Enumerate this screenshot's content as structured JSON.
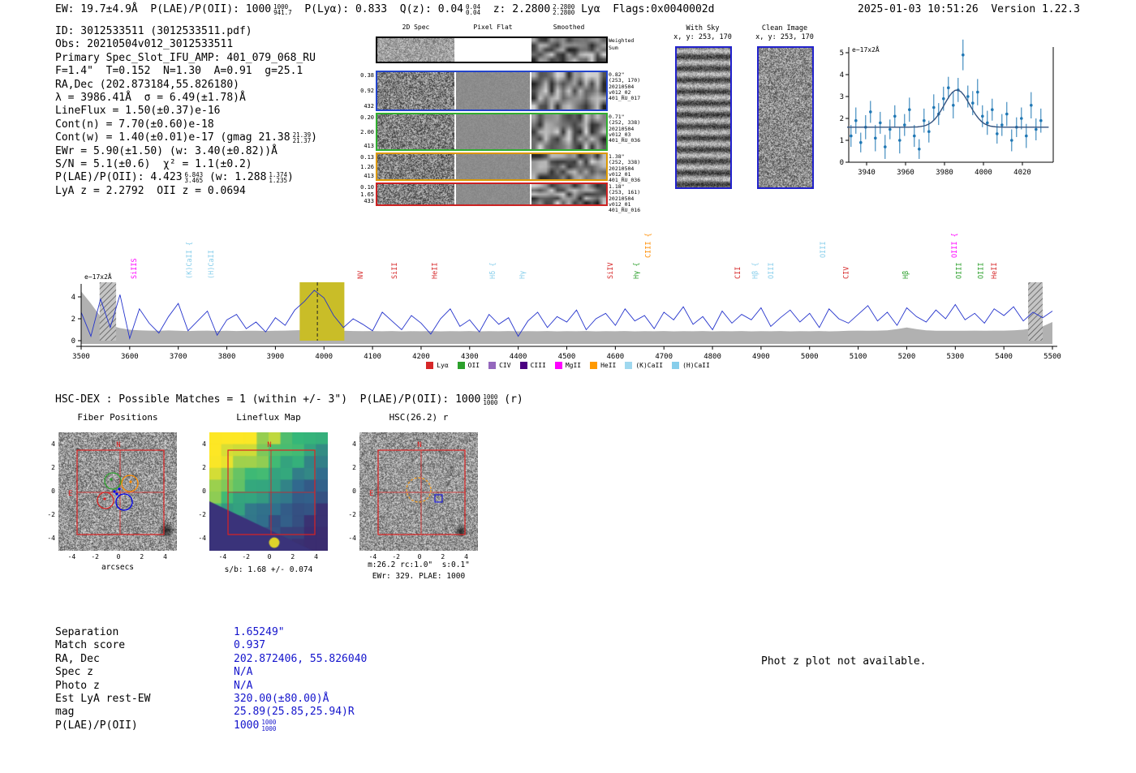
{
  "meta": {
    "datetime_version": "2025-01-03 10:51:26  Version 1.22.3"
  },
  "header_segments": [
    {
      "t": "EW: 19.7±4.9Å  P(LAE)/P(OII): 1000"
    },
    {
      "f": [
        "1000",
        "941.7"
      ]
    },
    {
      "t": "  P(Lyα): 0.833  Q(z): 0.04"
    },
    {
      "f": [
        "0.04",
        "0.04"
      ]
    },
    {
      "t": "  z: 2.2800"
    },
    {
      "f": [
        "2.2800",
        "2.2800"
      ]
    },
    {
      "t": " Lyα  Flags:0x0040002d"
    }
  ],
  "info_lines": [
    [
      {
        "t": "ID: 3012533511 (3012533511.pdf)"
      }
    ],
    [
      {
        "t": "Obs: 20210504v012_3012533511"
      }
    ],
    [
      {
        "t": "Primary Spec_Slot_IFU_AMP: 401_079_068_RU"
      }
    ],
    [
      {
        "t": "F=1.4\"  T=0.152  N=1.30  A=0.91  g=25.1"
      }
    ],
    [
      {
        "t": "RA,Dec (202.873184,55.826180)"
      }
    ],
    [
      {
        "t": "λ = 3986.41Å  σ = 6.49(±1.78)Å"
      }
    ],
    [
      {
        "t": "LineFlux = 1.50(±0.37)e-16"
      }
    ],
    [
      {
        "t": "Cont(n) = 7.70(±0.60)e-18"
      }
    ],
    [
      {
        "t": "Cont(w) = 1.40(±0.01)e-17 (gmag 21.38"
      },
      {
        "f": [
          "21.39",
          "21.37"
        ]
      },
      {
        "t": ")"
      }
    ],
    [
      {
        "t": "EWr = 5.90(±1.50) (w: 3.40(±0.82))Å"
      }
    ],
    [
      {
        "t": "S/N = 5.1(±0.6)  χ² = 1.1(±0.2)"
      }
    ],
    [
      {
        "t": "P(LAE)/P(OII): 4.423"
      },
      {
        "f": [
          "6.843",
          "3.465"
        ]
      },
      {
        "t": " (w: 1.288"
      },
      {
        "f": [
          "1.374",
          "1.235"
        ]
      },
      {
        "t": ")"
      }
    ],
    [
      {
        "t": "LyA z = 2.2792  OII z = 0.0694"
      }
    ]
  ],
  "cutouts": {
    "col_headers": [
      "2D Spec",
      "Pixel Flat",
      "Smoothed"
    ],
    "rows": [
      {
        "border": "#000000",
        "left": [],
        "right": [
          "Weighted",
          "Sum"
        ]
      },
      {
        "border": "#2244cc",
        "left": [
          "0.38",
          "0.92",
          "432"
        ],
        "right": [
          "0.82\"",
          "(253, 170)",
          "20210504",
          "v012_02",
          "401_RU_017"
        ]
      },
      {
        "border": "#2fae2f",
        "left": [
          "0.20",
          "2.00",
          "413"
        ],
        "right": [
          "0.71\"",
          "(252, 338)",
          "20210504",
          "v012_03",
          "401_RU_036"
        ]
      },
      {
        "border": "#dd9900",
        "left": [
          "0.13",
          "1.26",
          "413"
        ],
        "right": [
          "1.38\"",
          "(252, 338)",
          "20210504",
          "v012_01",
          "401_RU_036"
        ]
      },
      {
        "border": "#cc2222",
        "left": [
          "0.10",
          "1.65",
          "433"
        ],
        "right": [
          "1.18\"",
          "(253, 161)",
          "20210504",
          "v012_01",
          "401_RU_016"
        ]
      }
    ]
  },
  "sky_panels": [
    {
      "title": "With Sky",
      "coords": "x, y: 253, 170"
    },
    {
      "title": "Clean Image",
      "coords": "x, y: 253, 170"
    }
  ],
  "chart_data": [
    {
      "type": "scatter",
      "title": "1D line fit inset",
      "unit_label": {
        "base": "e",
        "exp": "−17",
        "mult": "x2Å"
      },
      "xticks": [
        3940,
        3960,
        3980,
        4000,
        4020
      ],
      "yticks": [
        0,
        1,
        2,
        3,
        4,
        5
      ],
      "xlim": [
        3928,
        4035
      ],
      "ylim": [
        -0.4,
        5.3
      ],
      "fit": {
        "center": 3986.41,
        "sigma": 6.49,
        "amplitude": 1.7,
        "baseline": 1.6
      },
      "points": {
        "x_start": 3932,
        "x_step": 2.5,
        "y": [
          1.2,
          1.9,
          0.9,
          1.6,
          2.3,
          1.1,
          1.8,
          0.7,
          1.5,
          2.1,
          1.0,
          1.7,
          2.4,
          1.2,
          0.6,
          1.9,
          1.4,
          2.5,
          2.2,
          2.9,
          3.4,
          2.6,
          3.3,
          4.9,
          3.0,
          2.7,
          3.2,
          2.1,
          1.8,
          2.4,
          1.3,
          1.7,
          2.2,
          1.0,
          1.6,
          2.0,
          1.2,
          2.6,
          1.5,
          1.9
        ],
        "yerr": [
          0.5,
          0.6,
          0.45,
          0.55,
          0.5,
          0.6,
          0.5,
          0.55,
          0.45,
          0.5,
          0.6,
          0.5,
          0.55,
          0.5,
          0.45,
          0.55,
          0.5,
          0.6,
          0.5,
          0.55,
          0.5,
          0.6,
          0.55,
          0.7,
          0.5,
          0.55,
          0.6,
          0.5,
          0.55,
          0.5,
          0.45,
          0.5,
          0.55,
          0.5,
          0.45,
          0.5,
          0.55,
          0.6,
          0.5,
          0.55
        ]
      }
    },
    {
      "type": "line",
      "title": "Full 1D spectrum",
      "unit_label": {
        "base": "e",
        "exp": "−17",
        "mult": "x2Å"
      },
      "xticks": [
        3500,
        3600,
        3700,
        3800,
        3900,
        4000,
        4100,
        4200,
        4300,
        4400,
        4500,
        4600,
        4700,
        4800,
        4900,
        5000,
        5100,
        5200,
        5300,
        5400,
        5500
      ],
      "yticks": [
        0,
        2,
        4
      ],
      "xlim": [
        3470,
        5540
      ],
      "ylim": [
        -0.8,
        5.2
      ],
      "peak_line": 3986.41,
      "highlight_band": [
        3950,
        4042
      ],
      "masked_bands": [
        [
          3538,
          3572
        ],
        [
          5450,
          5480
        ]
      ],
      "flux": {
        "x_start": 3500,
        "x_step": 20,
        "y": [
          2.6,
          0.4,
          3.8,
          1.2,
          4.2,
          0.2,
          2.9,
          1.6,
          0.7,
          2.2,
          3.4,
          0.9,
          1.8,
          2.7,
          0.5,
          1.9,
          2.4,
          1.1,
          1.7,
          0.8,
          2.1,
          1.4,
          2.8,
          3.6,
          4.6,
          3.9,
          2.3,
          1.2,
          2.0,
          1.5,
          0.9,
          2.6,
          1.8,
          1.0,
          2.3,
          1.6,
          0.6,
          2.0,
          2.9,
          1.3,
          1.9,
          0.8,
          2.4,
          1.5,
          2.1,
          0.4,
          1.8,
          2.6,
          1.2,
          2.2,
          1.7,
          2.8,
          1.0,
          2.0,
          2.5,
          1.4,
          2.9,
          1.8,
          2.3,
          1.1,
          2.6,
          1.9,
          3.1,
          1.5,
          2.2,
          1.0,
          2.7,
          1.6,
          2.4,
          1.9,
          3.0,
          1.3,
          2.1,
          2.8,
          1.7,
          2.5,
          1.2,
          2.9,
          2.0,
          1.6,
          2.4,
          3.2,
          1.8,
          2.6,
          1.4,
          3.0,
          2.2,
          1.7,
          2.8,
          2.0,
          3.3,
          1.9,
          2.5,
          1.6,
          2.9,
          2.3,
          3.1,
          1.8,
          2.6,
          2.1,
          2.7
        ]
      },
      "noise": {
        "x_start": 3500,
        "x_step": 20,
        "y": [
          4.5,
          3.4,
          2.2,
          1.4,
          1.15,
          1.0,
          0.95,
          0.92,
          0.9,
          0.93,
          0.9,
          0.88,
          0.9,
          0.92,
          0.89,
          0.9,
          0.88,
          0.9,
          0.91,
          0.89,
          0.9,
          0.92,
          0.95,
          0.97,
          0.98,
          0.96,
          0.93,
          0.9,
          0.88,
          0.87,
          0.88,
          0.86,
          0.88,
          0.85,
          0.87,
          0.86,
          0.88,
          0.85,
          0.87,
          0.86,
          0.88,
          0.85,
          0.87,
          0.86,
          0.88,
          0.85,
          0.87,
          0.86,
          0.88,
          0.85,
          0.87,
          0.86,
          0.88,
          0.85,
          0.87,
          0.86,
          0.88,
          0.85,
          0.87,
          0.86,
          0.88,
          0.85,
          0.87,
          0.86,
          0.88,
          0.85,
          0.87,
          0.86,
          0.88,
          0.85,
          0.87,
          0.86,
          0.88,
          0.85,
          0.87,
          0.86,
          0.88,
          0.85,
          0.87,
          0.9,
          0.92,
          0.9,
          0.92,
          0.95,
          1.05,
          1.2,
          1.05,
          0.95,
          0.9,
          0.9,
          0.9,
          0.9,
          0.92,
          0.9,
          0.92,
          0.92,
          0.95,
          1.0,
          1.15,
          1.3,
          1.7
        ]
      },
      "emission_labels": [
        {
          "wave": 3614,
          "text": "SiIIS",
          "color": "#ff00ff",
          "level": 0
        },
        {
          "wave": 3727,
          "text": "(K)CaII {",
          "color": "#87ceeb",
          "level": 0
        },
        {
          "wave": 3772,
          "text": "(H)CaII",
          "color": "#87ceeb",
          "level": 0
        },
        {
          "wave": 4080,
          "text": "NV",
          "color": "#d62728",
          "level": 0
        },
        {
          "wave": 4150,
          "text": "SiII",
          "color": "#d62728",
          "level": 0
        },
        {
          "wave": 4233,
          "text": "HeII",
          "color": "#d62728",
          "level": 0
        },
        {
          "wave": 4352,
          "text": "Hδ {",
          "color": "#87ceeb",
          "level": 0
        },
        {
          "wave": 4413,
          "text": "Hγ",
          "color": "#87ceeb",
          "level": 0
        },
        {
          "wave": 4594,
          "text": "SiIV",
          "color": "#d62728",
          "level": 0
        },
        {
          "wave": 4648,
          "text": "Hγ {",
          "color": "#2ca02c",
          "level": 0
        },
        {
          "wave": 4672,
          "text": "CIII {",
          "color": "#ff8c00",
          "level": 1
        },
        {
          "wave": 4857,
          "text": "CII",
          "color": "#d62728",
          "level": 0
        },
        {
          "wave": 4893,
          "text": "Hβ {",
          "color": "#87ceeb",
          "level": 0
        },
        {
          "wave": 4925,
          "text": "OIII",
          "color": "#87ceeb",
          "level": 0
        },
        {
          "wave": 5032,
          "text": "OIII",
          "color": "#87ceeb",
          "level": 1
        },
        {
          "wave": 5080,
          "text": "CIV",
          "color": "#d62728",
          "level": 0
        },
        {
          "wave": 5203,
          "text": "Hβ",
          "color": "#2ca02c",
          "level": 0
        },
        {
          "wave": 5303,
          "text": "OIII {",
          "color": "#ff00ff",
          "level": 1
        },
        {
          "wave": 5312,
          "text": "OIII",
          "color": "#2ca02c",
          "level": 0
        },
        {
          "wave": 5357,
          "text": "OIII",
          "color": "#2ca02c",
          "level": 0
        },
        {
          "wave": 5385,
          "text": "HeII",
          "color": "#d62728",
          "level": 0
        }
      ],
      "legend": [
        {
          "label": "Lyα",
          "color": "#d62728"
        },
        {
          "label": "OII",
          "color": "#2ca02c"
        },
        {
          "label": "CIV",
          "color": "#9467bd"
        },
        {
          "label": "CIII",
          "color": "#4b0082"
        },
        {
          "label": "MgII",
          "color": "#ff00ff"
        },
        {
          "label": "HeII",
          "color": "#ff9900"
        },
        {
          "label": "(K)CaII",
          "color": "#9fd8ef"
        },
        {
          "label": "(H)CaII",
          "color": "#87ceeb"
        }
      ]
    }
  ],
  "hsc_line_segments": [
    {
      "t": "HSC-DEX : Possible Matches = 1 (within +/- 3\")  P(LAE)/P(OII): 1000"
    },
    {
      "f": [
        "1000",
        "1000"
      ]
    },
    {
      "t": " (r)"
    }
  ],
  "panels": [
    {
      "title": "Fiber Positions",
      "xlabel": "arcsecs",
      "north_label": "N",
      "east_label": "E",
      "xticks": [
        -4,
        -2,
        0,
        2,
        4
      ],
      "yticks": [
        4,
        2,
        0,
        -2,
        -4
      ]
    },
    {
      "title": "Lineflux Map",
      "caption": "s/b: 1.68 +/- 0.074",
      "north_label": "N",
      "xticks": [
        -4,
        -2,
        0,
        2,
        4
      ],
      "yticks": [
        4,
        2,
        0,
        -2,
        -4
      ]
    },
    {
      "title": "HSC(26.2) r",
      "caption1": "m:26.2 rc:1.0\"  s:0.1\"",
      "caption2": "EWr: 329. PLAE: 1000",
      "north_label": "N",
      "east_label": "E",
      "xticks": [
        -4,
        -2,
        0,
        2,
        4
      ],
      "yticks": [
        4,
        2,
        0,
        -2,
        -4
      ]
    }
  ],
  "match_table": {
    "rows": [
      {
        "label": "Separation",
        "segs": [
          {
            "t": "1.65249\""
          }
        ]
      },
      {
        "label": "Match score",
        "segs": [
          {
            "t": "0.937"
          }
        ]
      },
      {
        "label": "RA, Dec",
        "segs": [
          {
            "t": "202.872406, 55.826040"
          }
        ]
      },
      {
        "label": "Spec z",
        "segs": [
          {
            "t": "N/A"
          }
        ]
      },
      {
        "label": "Photo z",
        "segs": [
          {
            "t": "N/A"
          }
        ]
      },
      {
        "label": "Est LyA rest-EW",
        "segs": [
          {
            "t": "320.00(±80.00)Å"
          }
        ]
      },
      {
        "label": "mag",
        "segs": [
          {
            "t": "25.89(25.85,25.94)R"
          }
        ]
      },
      {
        "label": "P(LAE)/P(OII)",
        "segs": [
          {
            "t": "1000"
          },
          {
            "f": [
              "1000",
              "1000"
            ]
          }
        ]
      }
    ]
  },
  "photz_note": "Phot z plot not available."
}
